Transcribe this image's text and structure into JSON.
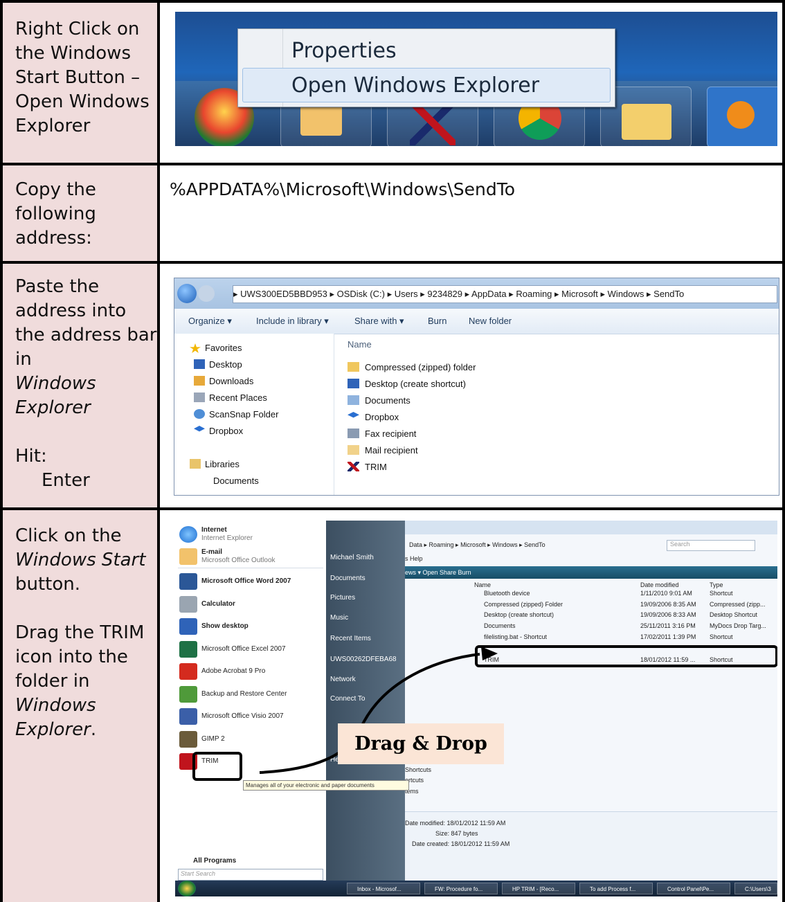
{
  "rows": [
    {
      "instruction": {
        "bold": "Right Click",
        "text": " on the Windows Start Button – Open Windows Explorer"
      },
      "screenshot": {
        "menu_items": [
          "Properties",
          "Open Windows Explorer"
        ]
      }
    },
    {
      "instruction": {
        "text": "Copy the following address:"
      },
      "address": "%APPDATA%\\Microsoft\\Windows\\SendTo"
    },
    {
      "instruction": {
        "text": "Paste the address into the address bar in",
        "italic": "Windows Explorer",
        "hit": "Hit:",
        "key": "Enter"
      },
      "explorer": {
        "address_bar": [
          "UWS300ED5BBD953",
          "OSDisk (C:)",
          "Users",
          "9234829",
          "AppData",
          "Roaming",
          "Microsoft",
          "Windows",
          "SendTo"
        ],
        "toolbar": [
          "Organize ▾",
          "Include in library ▾",
          "Share with ▾",
          "Burn",
          "New folder"
        ],
        "nav": [
          "Favorites",
          "Desktop",
          "Downloads",
          "Recent Places",
          "ScanSnap Folder",
          "Dropbox",
          "Libraries",
          "Documents"
        ],
        "column_header": "Name",
        "files": [
          "Compressed (zipped) folder",
          "Desktop (create shortcut)",
          "Documents",
          "Dropbox",
          "Fax recipient",
          "Mail recipient",
          "TRIM"
        ]
      }
    },
    {
      "instruction": {
        "p1a": "Click on the",
        "p1i": "Windows Start",
        "p1b": "button.",
        "p2a": "Drag the",
        "p2bold": "TRIM icon",
        "p2b": "into the folder in",
        "p2i": "Windows Explorer",
        "p2end": "."
      },
      "startmenu": {
        "pinned": [
          {
            "title": "Internet",
            "sub": "Internet Explorer"
          },
          {
            "title": "E-mail",
            "sub": "Microsoft Office Outlook"
          }
        ],
        "programs": [
          "Microsoft Office Word 2007",
          "Calculator",
          "Show desktop",
          "Microsoft Office Excel 2007",
          "Adobe Acrobat 9 Pro",
          "Backup and Restore Center",
          "Microsoft Office Visio 2007",
          "GIMP 2",
          "TRIM"
        ],
        "all_programs": "All Programs",
        "search_placeholder": "Start Search",
        "right": [
          "Michael Smith",
          "Documents",
          "Pictures",
          "Music",
          "Recent Items",
          "UWS00262DFEBA68",
          "Network",
          "Connect To",
          "Help and Support"
        ],
        "tooltip": "Manages all of your electronic and paper documents",
        "window": {
          "breadcrumb": "Data ▸ Roaming ▸ Microsoft ▸ Windows ▸ SendTo",
          "search": "Search",
          "menu": "s  Help",
          "toolbar": "ews ▾   Open   Share   Burn",
          "headers": [
            "Name",
            "Date modified",
            "Type"
          ],
          "rows": [
            [
              "Bluetooth device",
              "1/11/2010 9:01 AM",
              "Shortcut"
            ],
            [
              "Compressed (zipped) Folder",
              "19/09/2006 8:35 AM",
              "Compressed (zipp..."
            ],
            [
              "Desktop (create shortcut)",
              "19/09/2006 8:33 AM",
              "Desktop Shortcut"
            ],
            [
              "Documents",
              "25/11/2011 3:16 PM",
              "MyDocs Drop Targ..."
            ],
            [
              "filelisting.bat - Shortcut",
              "17/02/2011 1:39 PM",
              "Shortcut"
            ],
            [
              "TRIM",
              "18/01/2012 11:59 ...",
              "Shortcut"
            ]
          ],
          "side_text": [
            "Shortcuts",
            "ortcuts",
            "tems"
          ],
          "details": [
            "Date modified: 18/01/2012 11:59 AM",
            "Size: 847 bytes",
            "Date created: 18/01/2012 11:59 AM"
          ]
        },
        "taskbar": [
          "Inbox - Microsof...",
          "FW: Procedure fo...",
          "HP TRIM - [Reco...",
          "To add Process f...",
          "Control Panel\\Pe...",
          "C:\\Users\\3"
        ],
        "callout": "Drag & Drop"
      }
    }
  ],
  "colors": {
    "left_cell": "#f0dcdc",
    "callout": "#fbe5d6"
  }
}
